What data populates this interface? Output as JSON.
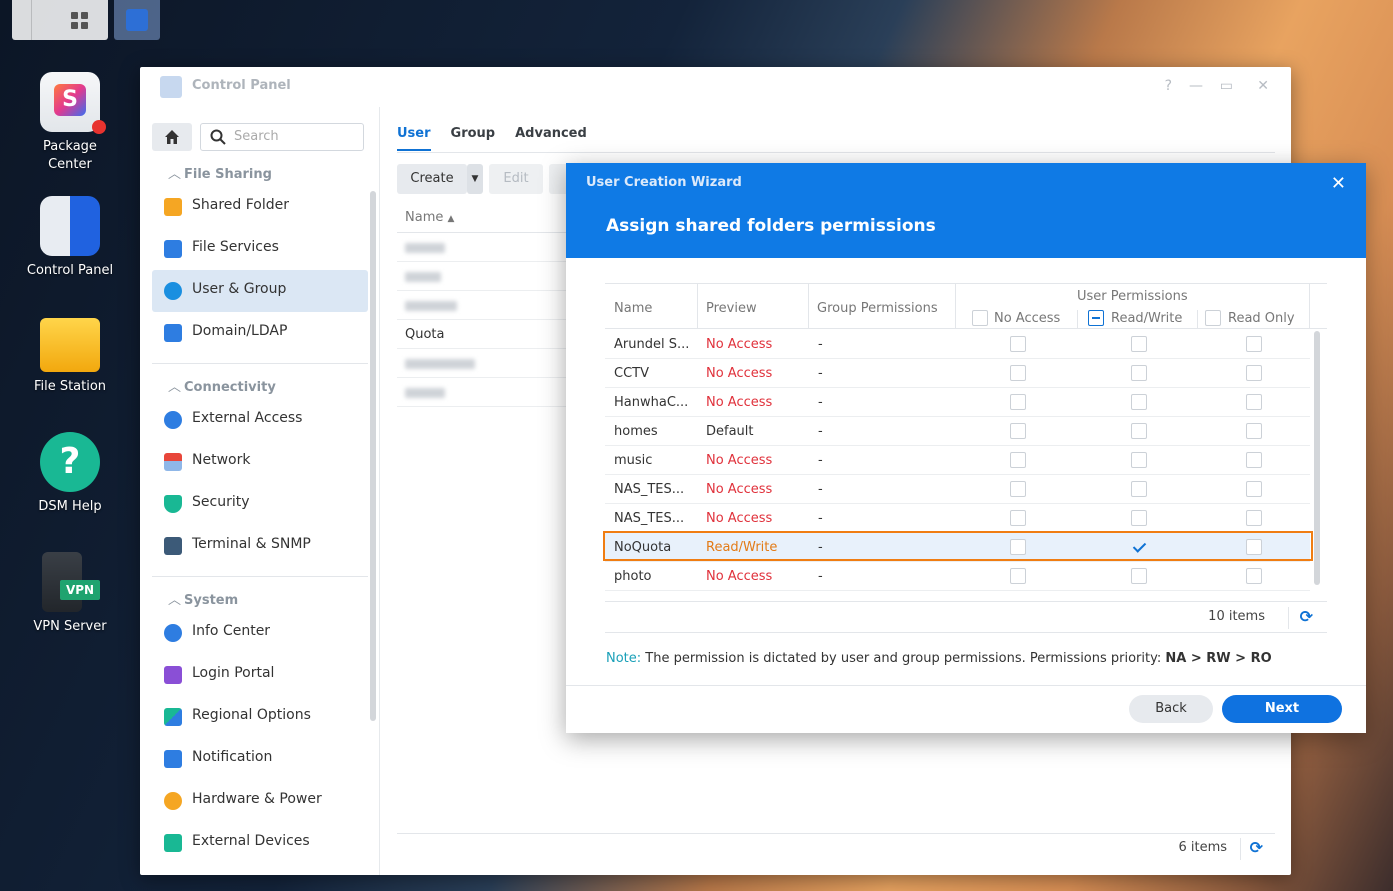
{
  "desktop": {
    "icons": [
      {
        "label": "Package Center",
        "icon": "package-center-icon"
      },
      {
        "label": "Control Panel",
        "icon": "control-panel-icon"
      },
      {
        "label": "File Station",
        "icon": "file-station-icon"
      },
      {
        "label": "DSM Help",
        "icon": "help-icon"
      },
      {
        "label": "VPN Server",
        "icon": "vpn-server-icon"
      }
    ],
    "vpn_badge": "VPN",
    "help_glyph": "?"
  },
  "control_panel": {
    "title": "Control Panel",
    "controls": {
      "help": "?",
      "minimize": "—",
      "maximize": "▭",
      "close": "✕"
    },
    "search": {
      "placeholder": "Search"
    },
    "sections": [
      {
        "title": "File Sharing",
        "items": [
          "Shared Folder",
          "File Services",
          "User & Group",
          "Domain/LDAP"
        ]
      },
      {
        "title": "Connectivity",
        "items": [
          "External Access",
          "Network",
          "Security",
          "Terminal & SNMP"
        ]
      },
      {
        "title": "System",
        "items": [
          "Info Center",
          "Login Portal",
          "Regional Options",
          "Notification",
          "Hardware & Power",
          "External Devices"
        ]
      }
    ],
    "active_item": "User & Group",
    "tabs": [
      "User",
      "Group",
      "Advanced"
    ],
    "toolbar": {
      "create": "Create",
      "edit": "Edit"
    },
    "user_list": {
      "header": "Name",
      "visible_row": "Quota",
      "count": "6 items"
    }
  },
  "wizard": {
    "title": "User Creation Wizard",
    "step": "Assign shared folders permissions",
    "columns": {
      "name": "Name",
      "preview": "Preview",
      "group": "Group Permissions",
      "user_permissions": "User Permissions",
      "no_access": "No Access",
      "read_write": "Read/Write",
      "read_only": "Read Only"
    },
    "rows": [
      {
        "name": "Arundel S...",
        "preview": "No Access",
        "group": "-",
        "rw": false
      },
      {
        "name": "CCTV",
        "preview": "No Access",
        "group": "-",
        "rw": false
      },
      {
        "name": "HanwhaC...",
        "preview": "No Access",
        "group": "-",
        "rw": false
      },
      {
        "name": "homes",
        "preview": "Default",
        "group": "-",
        "rw": false
      },
      {
        "name": "music",
        "preview": "No Access",
        "group": "-",
        "rw": false
      },
      {
        "name": "NAS_TES...",
        "preview": "No Access",
        "group": "-",
        "rw": false
      },
      {
        "name": "NAS_TES...",
        "preview": "No Access",
        "group": "-",
        "rw": false
      },
      {
        "name": "NoQuota",
        "preview": "Read/Write",
        "group": "-",
        "rw": true
      },
      {
        "name": "photo",
        "preview": "No Access",
        "group": "-",
        "rw": false
      }
    ],
    "count": "10 items",
    "note_label": "Note:",
    "note_text": "The permission is dictated by user and group permissions. Permissions priority:",
    "note_priority": "NA > RW > RO",
    "back": "Back",
    "next": "Next"
  }
}
